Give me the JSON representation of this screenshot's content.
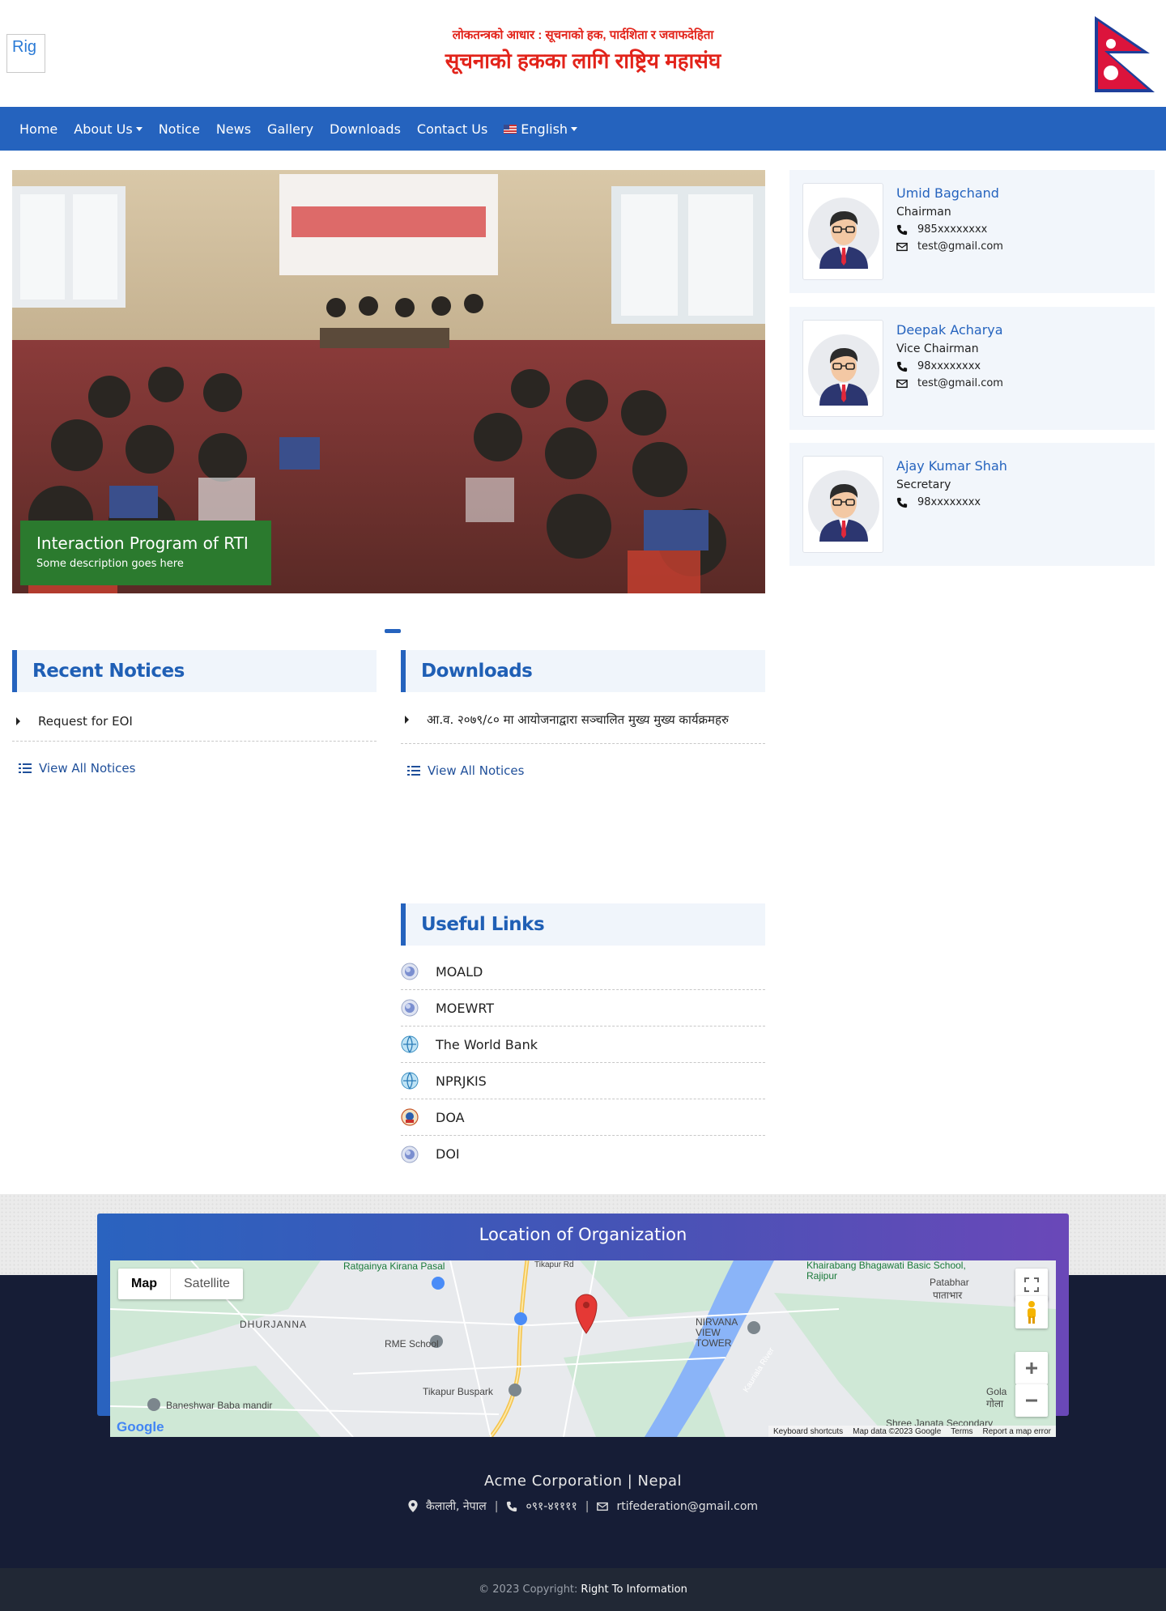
{
  "header": {
    "logo_alt": "Rig",
    "tagline": "लोकतन्त्रको आधार : सूचनाको हक, पार्दशिता र जवाफदेहिता",
    "org_title": "सूचनाको हकका लागि राष्ट्रिय महासंघ"
  },
  "nav": {
    "items": [
      {
        "label": "Home"
      },
      {
        "label": "About Us"
      },
      {
        "label": "Notice"
      },
      {
        "label": "News"
      },
      {
        "label": "Gallery"
      },
      {
        "label": "Downloads"
      },
      {
        "label": "Contact Us"
      }
    ],
    "language": "English"
  },
  "carousel": {
    "caption_title": "Interaction Program of RTI",
    "caption_desc": "Some description goes here"
  },
  "members": [
    {
      "name": "Umid Bagchand",
      "role": "Chairman",
      "phone": "985xxxxxxxx",
      "email": "test@gmail.com"
    },
    {
      "name": "Deepak Acharya",
      "role": "Vice Chairman",
      "phone": "98xxxxxxxx",
      "email": "test@gmail.com"
    },
    {
      "name": "Ajay Kumar Shah",
      "role": "Secretary",
      "phone": "98xxxxxxxx"
    }
  ],
  "notices": {
    "title": "Recent Notices",
    "items": [
      "Request for EOI"
    ],
    "view_all": "View All Notices"
  },
  "downloads": {
    "title": "Downloads",
    "items": [
      "आ.व. २०७९/८० मा आयोजनाद्वारा सञ्चालित मुख्य मुख्य कार्यक्रमहरु"
    ],
    "view_all": "View All Notices"
  },
  "useful_links": {
    "title": "Useful Links",
    "items": [
      {
        "label": "MOALD",
        "icon": "globe-icon"
      },
      {
        "label": "MOEWRT",
        "icon": "globe-icon"
      },
      {
        "label": "The World Bank",
        "icon": "globe-icon"
      },
      {
        "label": "NPRJKIS",
        "icon": "globe-icon"
      },
      {
        "label": "DOA",
        "icon": "emblem-icon"
      },
      {
        "label": "DOI",
        "icon": "globe-icon"
      }
    ]
  },
  "location": {
    "title": "Location of Organization",
    "map_tab": "Map",
    "satellite_tab": "Satellite",
    "labels": [
      "Ratgainya Kirana Pasal",
      "DHURJANNA",
      "RME School",
      "Tikapur Buspark",
      "Baneshwar Baba mandir",
      "NIRVANA VIEW TOWER",
      "Khairabang Bhagawati Basic School, Rajipur",
      "Patabhar",
      "पाताभार",
      "Gola",
      "गोला",
      "Shree Janata Secondary",
      "Kauriala River",
      "Tikapur Rd"
    ],
    "footer_links": [
      "Keyboard shortcuts",
      "Map data ©2023 Google",
      "Terms",
      "Report a map error"
    ],
    "google": "Google"
  },
  "footer": {
    "company": "Acme Corporation | Nepal",
    "address": "कैलाली, नेपाल",
    "phone": "०९१-४११११",
    "email": "rtifederation@gmail.com",
    "copyright_prefix": "© 2023 Copyright:",
    "copyright_brand": "Right To Information"
  },
  "colors": {
    "nav_bg": "#2563be",
    "accent": "#2563be",
    "title_red": "#e2231a",
    "footer_bg": "#161d36",
    "caption_bg": "#2b7a2e"
  }
}
